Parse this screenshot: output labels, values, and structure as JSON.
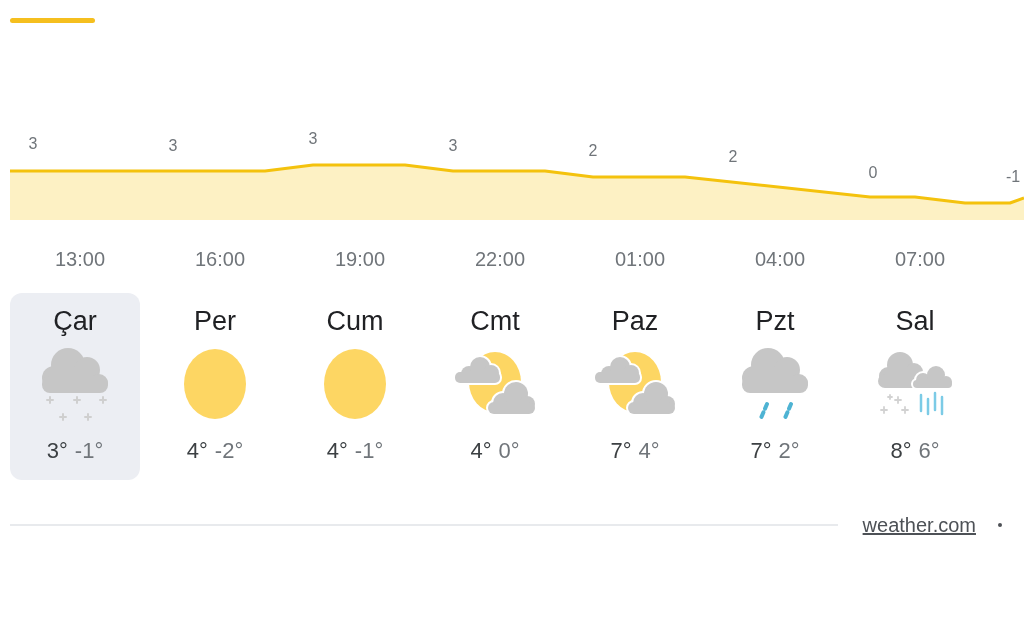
{
  "tabs": [
    {
      "selected": true
    }
  ],
  "temperature_graph": {
    "point_labels": [
      "3",
      "3",
      "3",
      "3",
      "2",
      "2",
      "0",
      "-1"
    ],
    "hour_labels": [
      "13:00",
      "16:00",
      "19:00",
      "22:00",
      "01:00",
      "04:00",
      "07:00"
    ]
  },
  "days": [
    {
      "name": "Çar",
      "kind": "snow",
      "high": "3°",
      "low": "-1°",
      "selected": true
    },
    {
      "name": "Per",
      "kind": "sunny",
      "high": "4°",
      "low": "-2°",
      "selected": false
    },
    {
      "name": "Cum",
      "kind": "sunny",
      "high": "4°",
      "low": "-1°",
      "selected": false
    },
    {
      "name": "Cmt",
      "kind": "partly_cloudy",
      "high": "4°",
      "low": "0°",
      "selected": false
    },
    {
      "name": "Paz",
      "kind": "partly_cloudy",
      "high": "7°",
      "low": "4°",
      "selected": false
    },
    {
      "name": "Pzt",
      "kind": "rain",
      "high": "7°",
      "low": "2°",
      "selected": false
    },
    {
      "name": "Sal",
      "kind": "snow_rain",
      "high": "8°",
      "low": "6°",
      "selected": false
    }
  ],
  "footer": {
    "source_link": "weather.com"
  }
}
